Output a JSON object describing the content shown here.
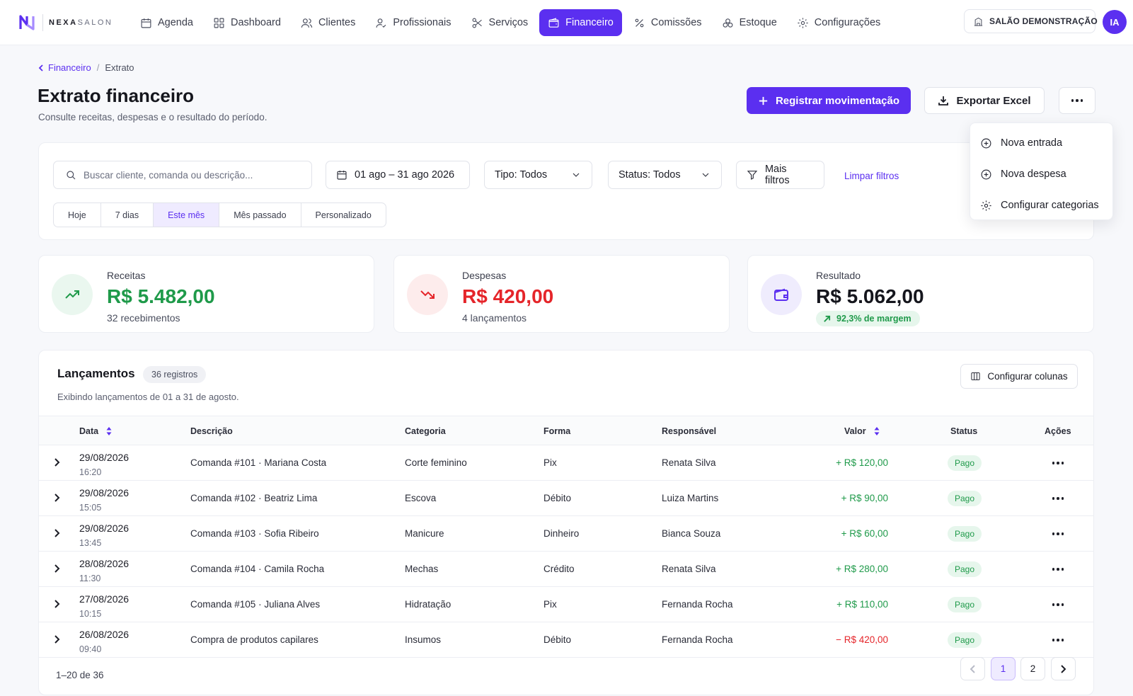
{
  "brand": {
    "name_bold": "NEXA",
    "name_light": "SALON",
    "accent": "#5b2ff0"
  },
  "nav": [
    {
      "label": "Agenda",
      "icon": "calendar-icon",
      "active": false
    },
    {
      "label": "Dashboard",
      "icon": "grid-icon",
      "active": false
    },
    {
      "label": "Clientes",
      "icon": "users-icon",
      "active": false
    },
    {
      "label": "Profissionais",
      "icon": "user-icon",
      "active": false
    },
    {
      "label": "Serviços",
      "icon": "scissors-icon",
      "active": false
    },
    {
      "label": "Financeiro",
      "icon": "wallet-icon",
      "active": true
    },
    {
      "label": "Comissões",
      "icon": "percent-icon",
      "active": false
    },
    {
      "label": "Estoque",
      "icon": "boxes-icon",
      "active": false
    },
    {
      "label": "Configurações",
      "icon": "gear-icon",
      "active": false
    }
  ],
  "salon": {
    "name": "SALÃO DEMONSTRAÇÃO"
  },
  "user": {
    "initials": "IA"
  },
  "breadcrumb": {
    "parent": "Financeiro",
    "current": "Extrato"
  },
  "header": {
    "title": "Extrato financeiro",
    "subtitle": "Consulte receitas, despesas e o resultado do período.",
    "primary_action": "Registrar movimentação",
    "export_action": "Exportar Excel"
  },
  "more_menu": [
    {
      "label": "Nova entrada",
      "icon": "plus-circle-icon"
    },
    {
      "label": "Nova despesa",
      "icon": "plus-circle-icon"
    },
    {
      "label": "Configurar categorias",
      "icon": "gear-icon"
    }
  ],
  "filters": {
    "search_placeholder": "Buscar cliente, comanda ou descrição...",
    "date_range": "01 ago – 31 ago 2026",
    "type": "Tipo: Todos",
    "status": "Status: Todos",
    "more": "Mais filtros",
    "clear": "Limpar filtros",
    "periods": [
      {
        "label": "Hoje",
        "active": false
      },
      {
        "label": "7 dias",
        "active": false
      },
      {
        "label": "Este mês",
        "active": true
      },
      {
        "label": "Mês passado",
        "active": false
      },
      {
        "label": "Personalizado",
        "active": false
      }
    ]
  },
  "summary": {
    "income": {
      "label": "Receitas",
      "value": "R$ 5.482,00",
      "sub": "32 recebimentos",
      "color": "#1f9a4a"
    },
    "expense": {
      "label": "Despesas",
      "value": "R$ 420,00",
      "sub": "4 lançamentos",
      "color": "#e5252a"
    },
    "result": {
      "label": "Resultado",
      "value": "R$ 5.062,00",
      "badge": "92,3% de margem",
      "color": "#15161d"
    }
  },
  "table": {
    "title": "Lançamentos",
    "count": "36 registros",
    "subtitle": "Exibindo lançamentos de 01 a 31 de agosto.",
    "config_columns": "Configurar colunas",
    "columns": {
      "date": "Data",
      "description": "Descrição",
      "category": "Categoria",
      "method": "Forma",
      "owner": "Responsável",
      "value": "Valor",
      "status": "Status",
      "actions": "Ações"
    },
    "rows": [
      {
        "date": "29/08/2026",
        "time": "16:20",
        "description": "Comanda #101 · Mariana Costa",
        "category": "Corte feminino",
        "method": "Pix",
        "owner": "Renata Silva",
        "value": "+ R$ 120,00",
        "kind": "income",
        "status": "Pago"
      },
      {
        "date": "29/08/2026",
        "time": "15:05",
        "description": "Comanda #102 · Beatriz Lima",
        "category": "Escova",
        "method": "Débito",
        "owner": "Luiza Martins",
        "value": "+ R$ 90,00",
        "kind": "income",
        "status": "Pago"
      },
      {
        "date": "29/08/2026",
        "time": "13:45",
        "description": "Comanda #103 · Sofia Ribeiro",
        "category": "Manicure",
        "method": "Dinheiro",
        "owner": "Bianca Souza",
        "value": "+ R$ 60,00",
        "kind": "income",
        "status": "Pago"
      },
      {
        "date": "28/08/2026",
        "time": "11:30",
        "description": "Comanda #104 · Camila Rocha",
        "category": "Mechas",
        "method": "Crédito",
        "owner": "Renata Silva",
        "value": "+ R$ 280,00",
        "kind": "income",
        "status": "Pago"
      },
      {
        "date": "27/08/2026",
        "time": "10:15",
        "description": "Comanda #105 · Juliana Alves",
        "category": "Hidratação",
        "method": "Pix",
        "owner": "Fernanda Rocha",
        "value": "+ R$ 110,00",
        "kind": "income",
        "status": "Pago"
      },
      {
        "date": "26/08/2026",
        "time": "09:40",
        "description": "Compra de produtos capilares",
        "category": "Insumos",
        "method": "Débito",
        "owner": "Fernanda Rocha",
        "value": "− R$ 420,00",
        "kind": "expense",
        "status": "Pago"
      }
    ]
  },
  "pagination": {
    "info": "1–20 de 36",
    "pages": [
      "1",
      "2"
    ],
    "current": "1"
  }
}
